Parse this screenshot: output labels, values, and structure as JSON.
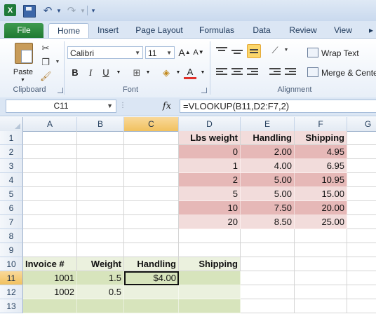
{
  "app": {
    "logo_letter": "X"
  },
  "tabs": [
    "File",
    "Home",
    "Insert",
    "Page Layout",
    "Formulas",
    "Data",
    "Review",
    "View"
  ],
  "ribbon": {
    "clipboard": {
      "paste_label": "Paste",
      "group_label": "Clipboard"
    },
    "font": {
      "name": "Calibri",
      "size": "11",
      "grow_label": "A",
      "shrink_label": "A",
      "bold": "B",
      "italic": "I",
      "underline": "U",
      "font_color_label": "A",
      "group_label": "Font"
    },
    "alignment": {
      "wrap_text": "Wrap Text",
      "merge_center": "Merge & Center",
      "group_label": "Alignment"
    }
  },
  "formula_bar": {
    "name_box": "C11",
    "fx_label": "fx",
    "formula": "=VLOOKUP(B11,D2:F7,2)"
  },
  "columns": [
    "A",
    "B",
    "C",
    "D",
    "E",
    "F",
    "G"
  ],
  "active_column": "C",
  "active_row": "11",
  "rows": [
    "1",
    "2",
    "3",
    "4",
    "5",
    "6",
    "7",
    "8",
    "9",
    "10",
    "11",
    "12",
    "13"
  ],
  "lookup_table": {
    "headers": [
      "Lbs weight",
      "Handling",
      "Shipping"
    ],
    "rows": [
      [
        "0",
        "2.00",
        "4.95"
      ],
      [
        "1",
        "4.00",
        "6.95"
      ],
      [
        "2",
        "5.00",
        "10.95"
      ],
      [
        "5",
        "5.00",
        "15.00"
      ],
      [
        "10",
        "7.50",
        "20.00"
      ],
      [
        "20",
        "8.50",
        "25.00"
      ]
    ]
  },
  "invoice_table": {
    "headers": [
      "Invoice #",
      "Weight",
      "Handling",
      "Shipping"
    ],
    "rows": [
      [
        "1001",
        "1.5",
        "$4.00",
        ""
      ],
      [
        "1002",
        "0.5",
        "",
        ""
      ],
      [
        "",
        "",
        "",
        ""
      ]
    ]
  },
  "colors": {
    "pink_dark": "#e6b8b7",
    "pink_light": "#f2dcdb",
    "green_dark": "#d7e4bc",
    "green_light": "#ebf1de",
    "file_tab": "#2a8a3e"
  }
}
